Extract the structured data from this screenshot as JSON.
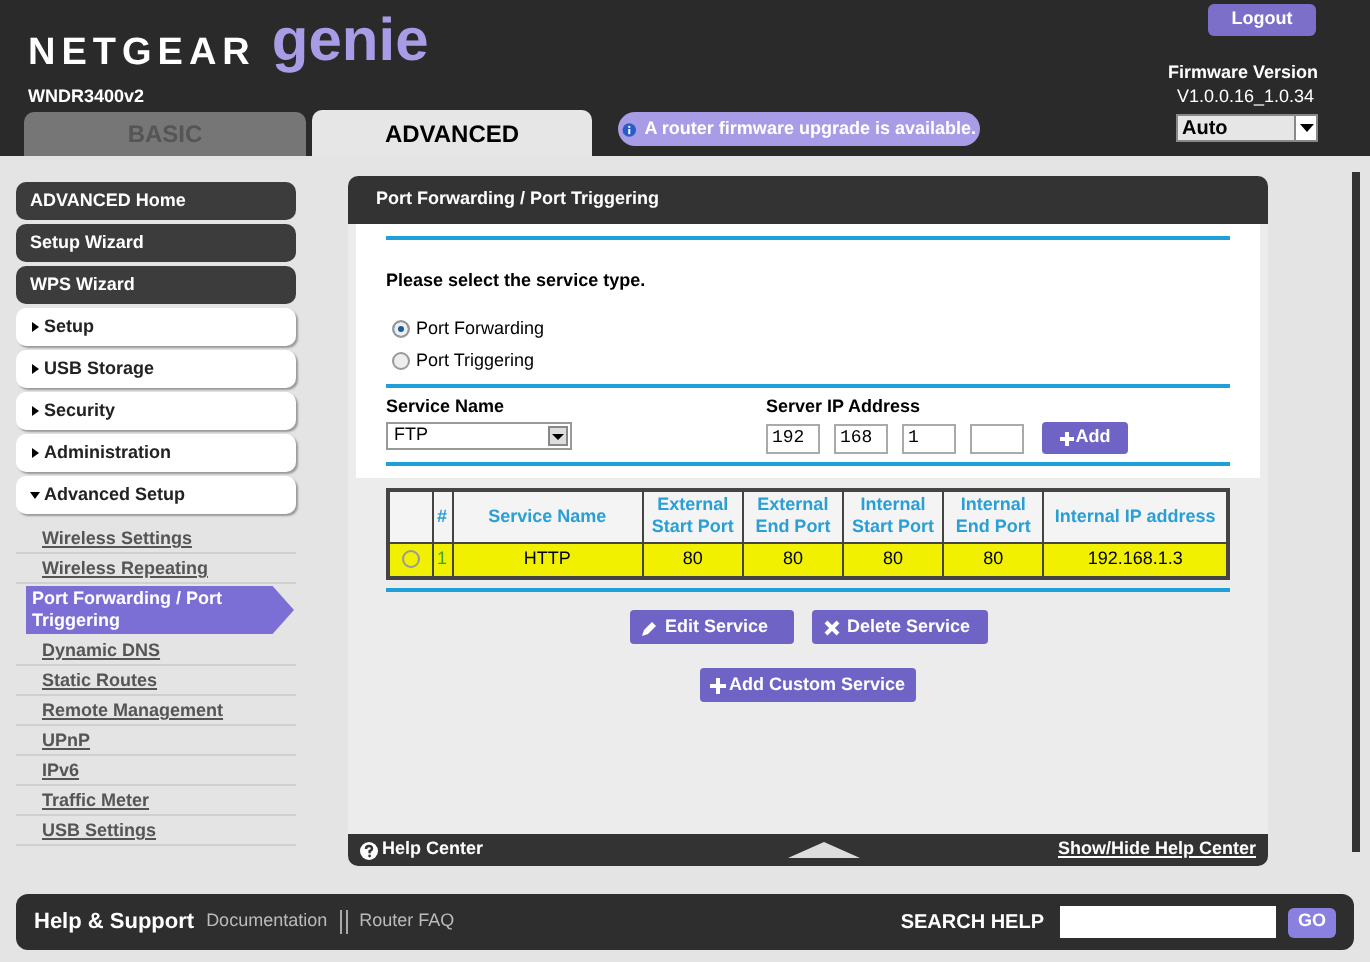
{
  "header": {
    "brand": "NETGEAR",
    "product": "genie",
    "model": "WNDR3400v2",
    "logout": "Logout",
    "firmware_label": "Firmware Version",
    "firmware_version": "V1.0.0.16_1.0.34",
    "language": "Auto"
  },
  "tabs": [
    {
      "label": "BASIC",
      "selected": false
    },
    {
      "label": "ADVANCED",
      "selected": true
    }
  ],
  "notice": "A router firmware upgrade is available.",
  "sidebar": {
    "items": [
      {
        "kind": "button",
        "label": "ADVANCED Home"
      },
      {
        "kind": "button",
        "label": "Setup Wizard"
      },
      {
        "kind": "button",
        "label": "WPS Wizard"
      },
      {
        "kind": "menu",
        "label": "Setup",
        "expanded": false
      },
      {
        "kind": "menu",
        "label": "USB Storage",
        "expanded": false
      },
      {
        "kind": "menu",
        "label": "Security",
        "expanded": false
      },
      {
        "kind": "menu",
        "label": "Administration",
        "expanded": false
      },
      {
        "kind": "menu",
        "label": "Advanced Setup",
        "expanded": true,
        "children": [
          {
            "label": "Wireless Settings",
            "selected": false
          },
          {
            "label": "Wireless Repeating",
            "selected": false
          },
          {
            "label": "Port Forwarding / Port Triggering",
            "selected": true
          },
          {
            "label": "Dynamic DNS",
            "selected": false
          },
          {
            "label": "Static Routes",
            "selected": false
          },
          {
            "label": "Remote Management",
            "selected": false
          },
          {
            "label": "UPnP",
            "selected": false
          },
          {
            "label": "IPv6",
            "selected": false
          },
          {
            "label": "Traffic Meter",
            "selected": false
          },
          {
            "label": "USB Settings",
            "selected": false
          }
        ]
      }
    ]
  },
  "panel": {
    "title": "Port Forwarding / Port Triggering",
    "prompt": "Please select the service type.",
    "service_types": [
      {
        "label": "Port Forwarding",
        "selected": true
      },
      {
        "label": "Port Triggering",
        "selected": false
      }
    ],
    "service_name": {
      "label": "Service Name",
      "value": "FTP"
    },
    "server_ip": {
      "label": "Server IP Address",
      "octets": [
        {
          "kind": "filled",
          "value": "192"
        },
        {
          "kind": "filled",
          "value": "168"
        },
        {
          "kind": "filled",
          "value": "1"
        },
        {
          "kind": "blank"
        }
      ],
      "add": "Add"
    },
    "table": {
      "columns": [
        "#",
        "Service Name",
        "External Start Port",
        "External End Port",
        "Internal Start Port",
        "Internal End Port",
        "Internal IP address"
      ],
      "rows": [
        {
          "selected": false,
          "highlighted": true,
          "cells": [
            "1",
            "HTTP",
            "80",
            "80",
            "80",
            "80",
            "192.168.1.3"
          ]
        }
      ]
    },
    "buttons": [
      "Edit Service",
      "Delete Service"
    ],
    "add_custom": "Add Custom Service",
    "help_center": "Help Center",
    "toggle_help": "Show/Hide Help Center"
  },
  "footer": {
    "title": "Help & Support",
    "links": [
      "Documentation",
      "Router FAQ"
    ],
    "search_label": "SEARCH HELP",
    "go": "GO"
  }
}
